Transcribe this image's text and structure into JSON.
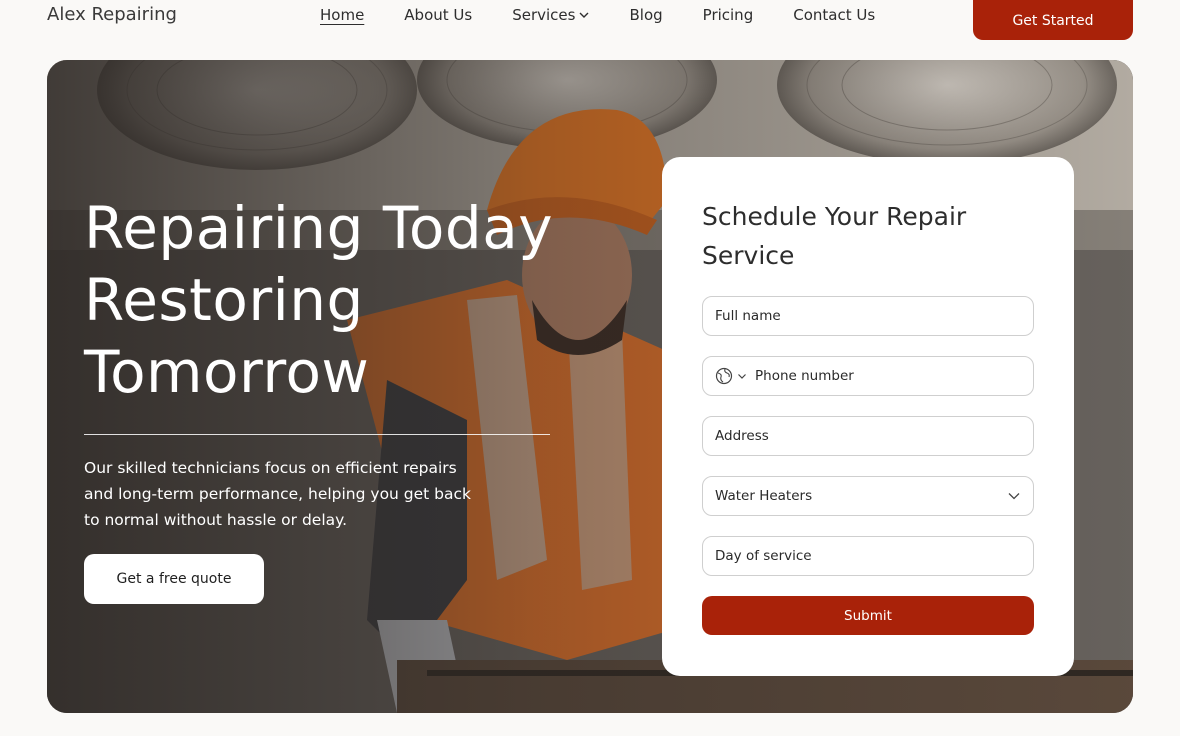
{
  "brand": "Alex Repairing",
  "nav": {
    "items": [
      {
        "label": "Home",
        "active": true
      },
      {
        "label": "About Us"
      },
      {
        "label": "Services",
        "has_dropdown": true
      },
      {
        "label": "Blog"
      },
      {
        "label": "Pricing"
      },
      {
        "label": "Contact Us"
      }
    ],
    "cta_label": "Get Started"
  },
  "hero": {
    "headline_lines": [
      "Repairing Today",
      "Restoring",
      "Tomorrow"
    ],
    "subtext": "Our skilled technicians focus on efficient repairs and long-term performance, helping you get back to normal without hassle or delay.",
    "button_label": "Get a free quote"
  },
  "form": {
    "title": "Schedule Your Repair Service",
    "full_name_placeholder": "Full name",
    "phone_placeholder": "Phone number",
    "address_placeholder": "Address",
    "service_selected": "Water Heaters",
    "day_placeholder": "Day of service",
    "submit_label": "Submit"
  },
  "colors": {
    "accent": "#a92209",
    "page_bg": "#faf9f7",
    "vest": "#ee7a2a",
    "helmet": "#f07a22"
  }
}
